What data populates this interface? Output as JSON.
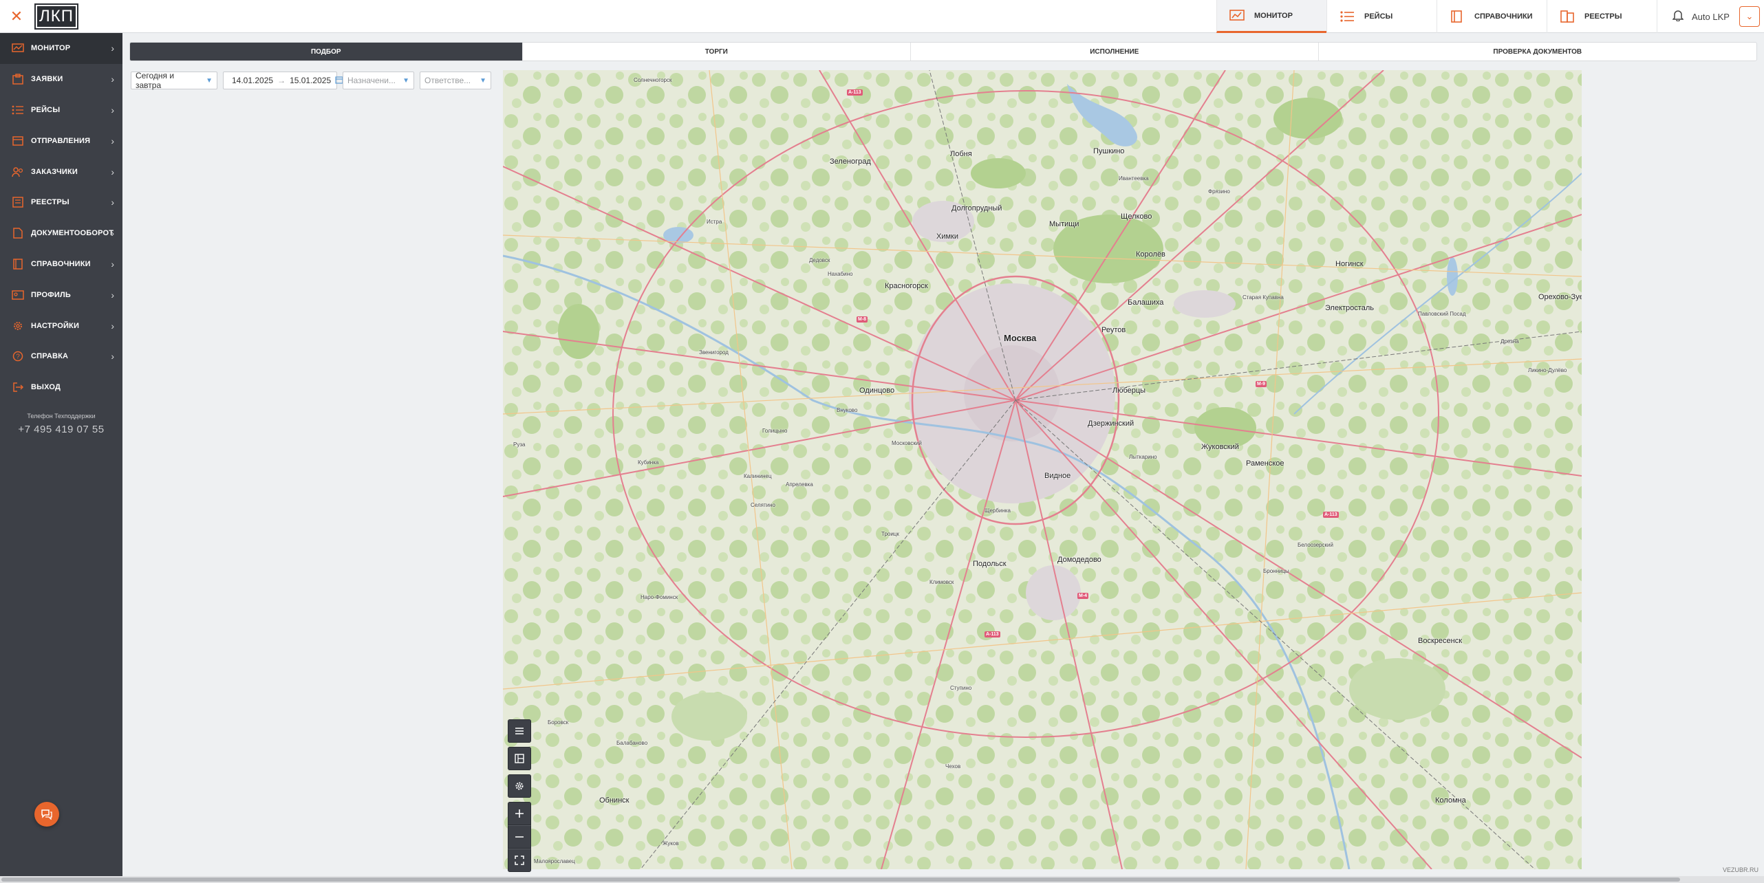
{
  "header": {
    "logo_text": "ЛКП",
    "nav": [
      {
        "label": "МОНИТОР",
        "icon": "monitor-chart-icon",
        "active": true
      },
      {
        "label": "РЕЙСЫ",
        "icon": "list-icon",
        "active": false
      },
      {
        "label": "СПРАВОЧНИКИ",
        "icon": "book-icon",
        "active": false
      },
      {
        "label": "РЕЕСТРЫ",
        "icon": "registry-icon",
        "active": false
      }
    ],
    "user_name": "Auto LKP"
  },
  "sidebar": {
    "items": [
      {
        "label": "МОНИТОР",
        "icon": "monitor-icon",
        "active": true
      },
      {
        "label": "ЗАЯВКИ",
        "icon": "requests-icon",
        "active": false
      },
      {
        "label": "РЕЙСЫ",
        "icon": "trips-icon",
        "active": false
      },
      {
        "label": "ОТПРАВЛЕНИЯ",
        "icon": "shipments-icon",
        "active": false
      },
      {
        "label": "ЗАКАЗЧИКИ",
        "icon": "customers-icon",
        "active": false
      },
      {
        "label": "РЕЕСТРЫ",
        "icon": "registry-icon",
        "active": false
      },
      {
        "label": "ДОКУМЕНТООБОРОТ",
        "icon": "documents-icon",
        "active": false
      },
      {
        "label": "СПРАВОЧНИКИ",
        "icon": "book-icon",
        "active": false
      },
      {
        "label": "ПРОФИЛЬ",
        "icon": "profile-icon",
        "active": false
      },
      {
        "label": "НАСТРОЙКИ",
        "icon": "gear-icon",
        "active": false
      },
      {
        "label": "СПРАВКА",
        "icon": "help-icon",
        "active": false
      },
      {
        "label": "ВЫХОД",
        "icon": "logout-icon",
        "active": false
      }
    ],
    "support_title": "Телефон Техподдержки",
    "support_phone": "+7 495 419 07 55"
  },
  "tabs": [
    {
      "label": "ПОДБОР",
      "active": true
    },
    {
      "label": "ТОРГИ",
      "active": false
    },
    {
      "label": "ИСПОЛНЕНИЕ",
      "active": false
    },
    {
      "label": "ПРОВЕРКА ДОКУМЕНТОВ",
      "active": false
    }
  ],
  "filters": {
    "period": "Сегодня и завтра",
    "date_from": "14.01.2025",
    "date_sep": "→",
    "date_to": "15.01.2025",
    "assignment_placeholder": "Назначени...",
    "responsible_placeholder": "Ответстве..."
  },
  "map": {
    "cities_big": [
      "Москва"
    ],
    "cities": [
      "Зеленоград",
      "Долгопрудный",
      "Химки",
      "Мытищи",
      "Пушкино",
      "Щелково",
      "Королёв",
      "Красногорск",
      "Балашиха",
      "Реутов",
      "Ногинск",
      "Электросталь",
      "Орехово-Зуево",
      "Одинцово",
      "Люберцы",
      "Жуковский",
      "Раменское",
      "Видное",
      "Подольск",
      "Домодедово",
      "Воскресенск",
      "Коломна",
      "Обнинск",
      "Лобня",
      "Дзержинский"
    ],
    "cities_small": [
      "Истра",
      "Дедовск",
      "Нахабино",
      "Звенигород",
      "Кубинка",
      "Голицыно",
      "Апрелевка",
      "Наро-Фоминск",
      "Троицк",
      "Щербинка",
      "Климовск",
      "Чехов",
      "Ступино",
      "Бронницы",
      "Белоозерский",
      "Старая Купавна",
      "Фрязино",
      "Ивантеевка",
      "Лыткарино",
      "Селятино",
      "Калининец",
      "Боровск",
      "Балабаново",
      "Жуков",
      "Малоярославец",
      "Московский",
      "Внуково",
      "Солнечногорск",
      "Павловский Посад",
      "Дрезна",
      "Ликино-Дулёво",
      "Руза"
    ],
    "road_labels": [
      "A-113",
      "M-8",
      "M-9",
      "M-4",
      "A-113",
      "A-113"
    ],
    "controls": [
      "menu-icon",
      "layers-icon",
      "settings-icon",
      "zoom-in-icon",
      "zoom-out-icon",
      "fullscreen-icon"
    ],
    "attribution": "VEZUBR.RU"
  }
}
